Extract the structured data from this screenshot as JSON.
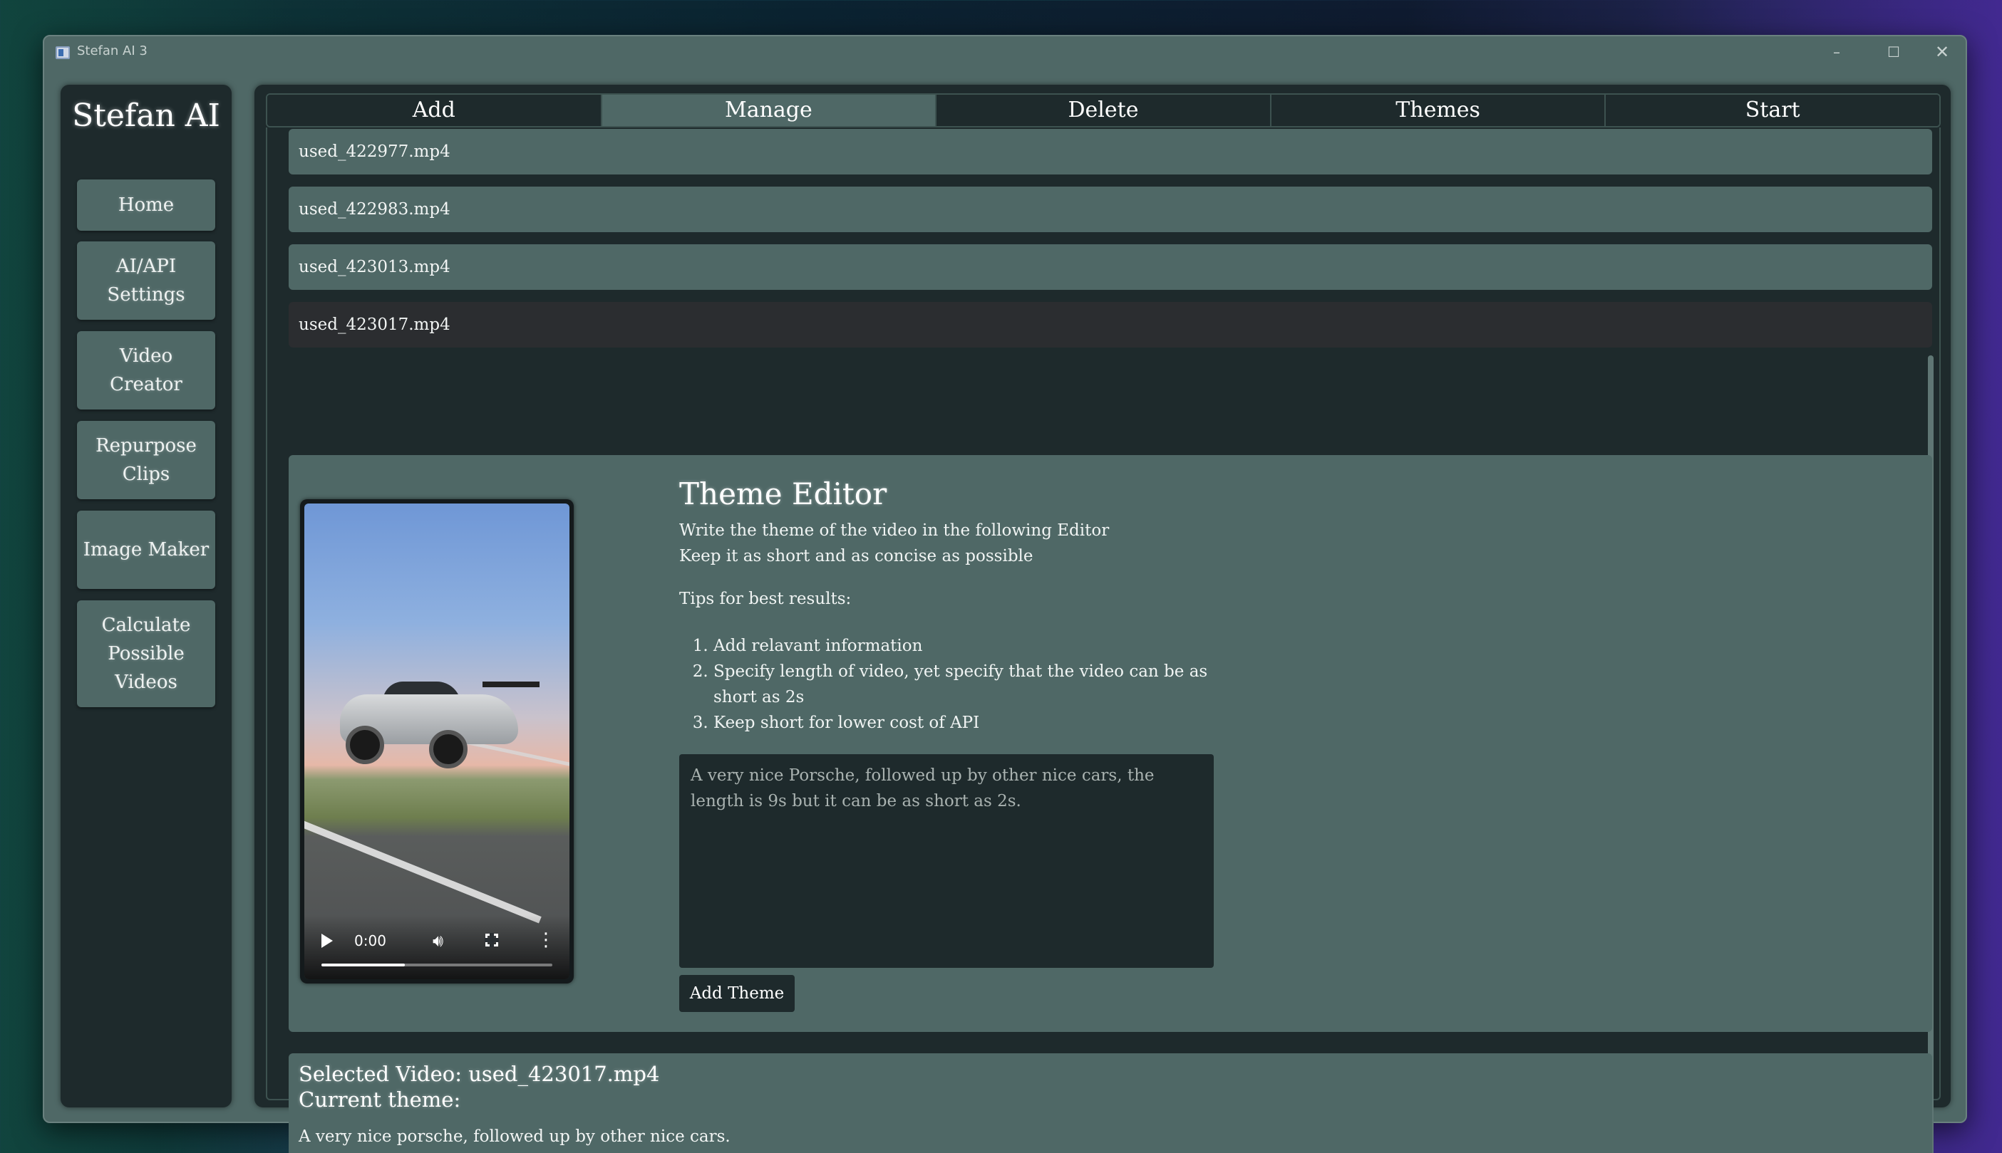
{
  "window": {
    "title": "Stefan AI 3",
    "controls": {
      "minimize": "–",
      "maximize": "☐",
      "close": "✕"
    }
  },
  "sidebar": {
    "brand": "Stefan AI",
    "items": [
      {
        "label": "Home"
      },
      {
        "label": "AI/API Settings"
      },
      {
        "label": "Video Creator"
      },
      {
        "label": "Repurpose Clips"
      },
      {
        "label": "Image Maker"
      },
      {
        "label": "Calculate Possible Videos"
      }
    ]
  },
  "tabs": [
    {
      "label": "Add",
      "active": false
    },
    {
      "label": "Manage",
      "active": true
    },
    {
      "label": "Delete",
      "active": false
    },
    {
      "label": "Themes",
      "active": false
    },
    {
      "label": "Start",
      "active": false
    }
  ],
  "files": [
    {
      "name": "used_422977.mp4",
      "selected": false
    },
    {
      "name": "used_422983.mp4",
      "selected": false
    },
    {
      "name": "used_423013.mp4",
      "selected": false
    },
    {
      "name": "used_423017.mp4",
      "selected": true
    }
  ],
  "video_player": {
    "time": "0:00",
    "progress": 0.36
  },
  "theme_editor": {
    "title": "Theme Editor",
    "line1": "Write the theme of the video in the following Editor",
    "line2": "Keep it as short and as concise as possible",
    "tips_heading": "Tips for best results:",
    "tips": [
      "Add relavant information",
      "Specify length of video, yet specify that the video can be as short as 2s",
      "Keep short for lower cost of API"
    ],
    "placeholder": "A very nice Porsche, followed up by other nice cars, the length is 9s but it can be as short as 2s.",
    "button": "Add Theme"
  },
  "info": {
    "selected_video": "Selected Video: used_423017.mp4",
    "current_theme_label": "Current theme:",
    "current_theme": "A very nice porsche, followed up by other nice cars."
  },
  "colors": {
    "panel": "#4f6866",
    "dark": "#1e2a2c",
    "selected": "#2b2d30"
  }
}
